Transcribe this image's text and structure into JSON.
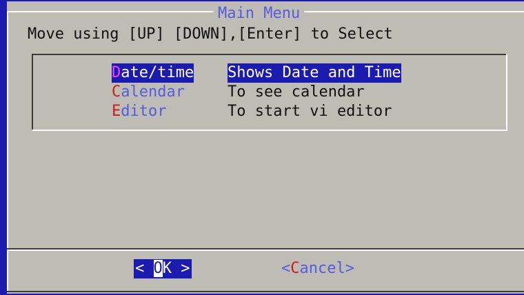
{
  "dialog": {
    "title": "Main Menu",
    "instructions": "Move using [UP] [DOWN],[Enter] to Select"
  },
  "menu": {
    "items": [
      {
        "hotkey": "D",
        "tag_rest": "ate/time",
        "description": "Shows Date and Time",
        "selected": true
      },
      {
        "hotkey": "C",
        "tag_rest": "alendar",
        "description": "To see calendar",
        "selected": false
      },
      {
        "hotkey": "E",
        "tag_rest": "ditor",
        "description": "To start vi editor",
        "selected": false
      }
    ]
  },
  "buttons": {
    "ok": {
      "left": "< ",
      "cursor": "O",
      "rest": "K >"
    },
    "cancel": {
      "open": "<",
      "hotkey": "C",
      "rest": "ancel>"
    }
  },
  "colors": {
    "background": "#1b1bb0",
    "dialog": "#bdbdb5",
    "highlight": "#1b1bb0",
    "hotkey": "#cc1a1a",
    "tag_text": "#5a5ae0"
  }
}
